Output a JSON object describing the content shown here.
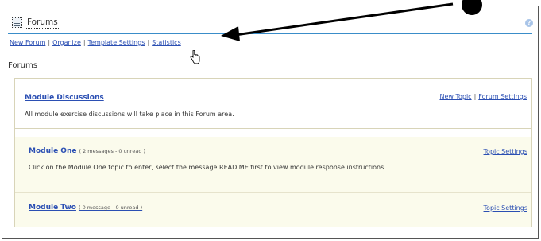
{
  "header": {
    "title": "Forums",
    "help_label": "?"
  },
  "toolbar": {
    "new_forum": "New Forum",
    "organize": "Organize",
    "template_settings": "Template Settings",
    "statistics": "Statistics",
    "separator": "|"
  },
  "section_title": "Forums",
  "forum": {
    "title": "Module Discussions",
    "description": "All module exercise discussions will take place in this Forum area.",
    "new_topic": "New Topic",
    "forum_settings": "Forum Settings",
    "separator": "|"
  },
  "topics": [
    {
      "title": "Module One",
      "meta": "( 2 messages - 0 unread )",
      "settings": "Topic Settings",
      "description": "Click on the Module One topic to enter, select the message READ ME first to view module response instructions."
    },
    {
      "title": "Module Two",
      "meta": "( 0 message - 0 unread )",
      "settings": "Topic Settings",
      "description": ""
    }
  ],
  "colors": {
    "link": "#2b4fb3",
    "title_rule": "#3a8dc9",
    "topic_background": "#fbfbec",
    "help_icon": "#a8c4e8"
  }
}
